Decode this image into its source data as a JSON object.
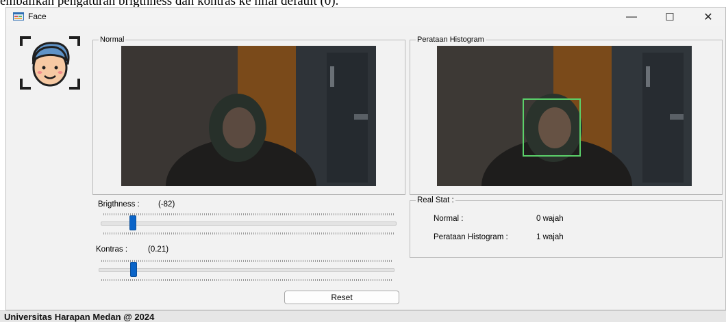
{
  "document": {
    "caption_fragment": "embalikan pengaturan brigthness dan kontras ke nilai default (0)."
  },
  "window": {
    "title": "Face",
    "minimize_glyph": "—",
    "maximize_glyph": "☐",
    "close_glyph": "✕"
  },
  "icons": {
    "app": "form-app-icon",
    "logo": "face-scan-icon"
  },
  "normal_group": {
    "label": "Normal"
  },
  "histogram_group": {
    "label": "Perataan Histogram"
  },
  "controls": {
    "brightness_label": "Brigthness :",
    "brightness_value": "(-82)",
    "brightness_level_fraction": 0.1,
    "contrast_label": "Kontras :",
    "contrast_value": "(0.21)",
    "contrast_level_fraction": 0.11,
    "reset_label": "Reset"
  },
  "real_stat": {
    "label": "Real Stat :",
    "rows": [
      {
        "name": "Normal :",
        "value": "0 wajah"
      },
      {
        "name": "Perataan Histogram :",
        "value": "1 wajah"
      }
    ]
  },
  "status": {
    "text": "Universitas Harapan Medan @ 2024"
  },
  "colors": {
    "accent": "#0a64c8",
    "face_box": "#5bd16a",
    "wall_orange": "#7a4a1a"
  }
}
